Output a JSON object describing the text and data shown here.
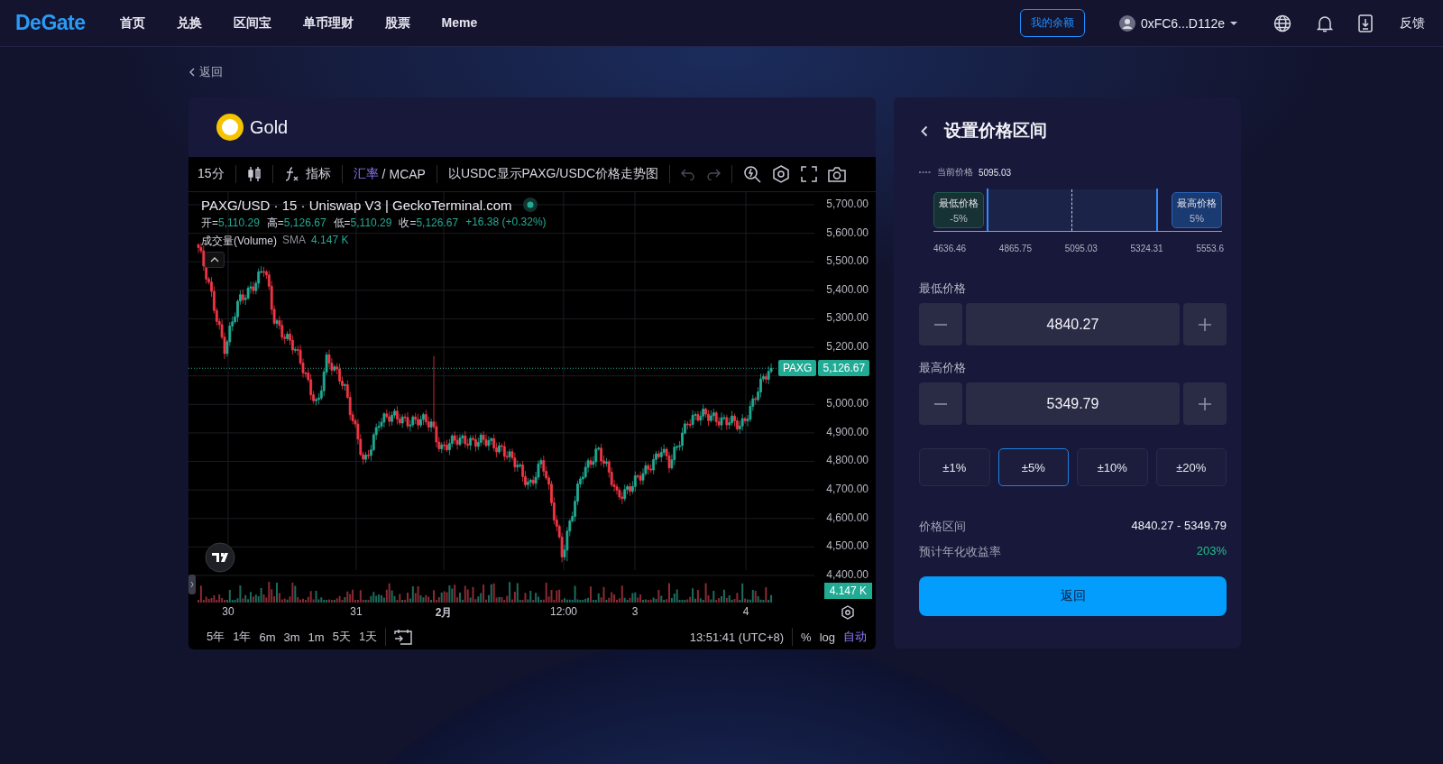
{
  "header": {
    "logo": "DeGate",
    "nav": [
      {
        "label": "首页"
      },
      {
        "label": "兑换"
      },
      {
        "label": "区间宝"
      },
      {
        "label": "单币理财"
      },
      {
        "label": "股票"
      },
      {
        "label": "Meme"
      }
    ],
    "balance_button": "我的余额",
    "account": "0xFC6...D112e",
    "feedback": "反馈"
  },
  "back_link": "返回",
  "asset": {
    "name": "Gold"
  },
  "chart_toolbar": {
    "interval": "15分",
    "indicators": "指标",
    "rate_options": [
      {
        "label": "汇率",
        "selected": true
      },
      {
        "label": "MCAP",
        "selected": false
      }
    ],
    "rate_separator": "/",
    "caption": "以USDC显示PAXG/USDC价格走势图"
  },
  "legend": {
    "title": "PAXG/USD · 15 · Uniswap V3 | GeckoTerminal.com",
    "ohlc": [
      {
        "label": "开=",
        "value": "5,110.29"
      },
      {
        "label": "高=",
        "value": "5,126.67"
      },
      {
        "label": "低=",
        "value": "5,110.29"
      },
      {
        "label": "收=",
        "value": "5,126.67"
      }
    ],
    "change": "+16.38 (+0.32%)",
    "volume_label": "成交量(Volume)",
    "sma": "SMA",
    "volume_value": "4.147 K"
  },
  "price_axis": [
    "5,700.00",
    "5,600.00",
    "5,500.00",
    "5,400.00",
    "5,300.00",
    "5,200.00",
    "5,000.00",
    "4,900.00",
    "4,800.00",
    "4,700.00",
    "4,600.00",
    "4,500.00",
    "4,400.00"
  ],
  "price_tag": {
    "symbol": "PAXG",
    "price": "5,126.67"
  },
  "volume_tag": "4.147 K",
  "time_axis": [
    {
      "label": "30",
      "bold": false
    },
    {
      "label": "31",
      "bold": false
    },
    {
      "label": "2月",
      "bold": true
    },
    {
      "label": "12:00",
      "bold": false
    },
    {
      "label": "3",
      "bold": false
    },
    {
      "label": "4",
      "bold": false
    }
  ],
  "ranges": [
    {
      "label": "5年"
    },
    {
      "label": "1年"
    },
    {
      "label": "6m"
    },
    {
      "label": "3m"
    },
    {
      "label": "1m"
    },
    {
      "label": "5天"
    },
    {
      "label": "1天"
    }
  ],
  "clock": "13:51:41 (UTC+8)",
  "scale_options": [
    {
      "label": "%",
      "selected": false
    },
    {
      "label": "log",
      "selected": false
    },
    {
      "label": "自动",
      "selected": true
    }
  ],
  "panel": {
    "title": "设置价格区间",
    "current_price_label": "当前价格",
    "current_price": "5095.03",
    "range_markers": [
      {
        "label": "最低价格",
        "percent": "-5%",
        "kind": "low"
      },
      {
        "label": "最高价格",
        "percent": "5%",
        "kind": "high"
      }
    ],
    "range_axis": [
      "4636.46",
      "4865.75",
      "5095.03",
      "5324.31",
      "5553.6"
    ],
    "fields": [
      {
        "label": "最低价格",
        "value": "4840.27"
      },
      {
        "label": "最高价格",
        "value": "5349.79"
      }
    ],
    "presets": [
      {
        "label": "±1%",
        "selected": false
      },
      {
        "label": "±5%",
        "selected": true
      },
      {
        "label": "±10%",
        "selected": false
      },
      {
        "label": "±20%",
        "selected": false
      }
    ],
    "summary": [
      {
        "label": "价格区间",
        "value": "4840.27 - 5349.79",
        "kind": "plain"
      },
      {
        "label": "预计年化收益率",
        "value": "203%",
        "kind": "positive"
      }
    ],
    "submit": "返回"
  }
}
